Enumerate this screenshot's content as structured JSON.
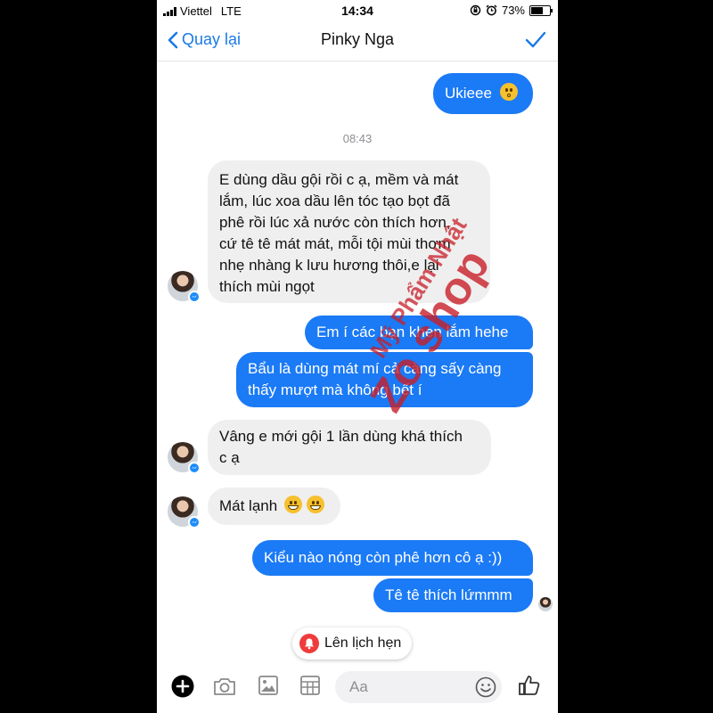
{
  "status_bar": {
    "carrier": "Viettel",
    "network": "LTE",
    "time": "14:34",
    "battery": "73%",
    "battery_level": 0.73,
    "icons": [
      "signal-icon",
      "orientation-lock-icon",
      "alarm-icon",
      "battery-icon"
    ]
  },
  "header": {
    "back_label": "Quay lại",
    "title": "Pinky Nga",
    "done_icon": "checkmark-icon"
  },
  "messages": {
    "m1": "Ukieee",
    "timestamp": "08:43",
    "m2_lines": [
      "E dùng dầu gội rồi c ạ, mềm và mát",
      "lắm, lúc xoa dầu lên tóc tạo bọt đã",
      "phê rồi lúc xả nước còn thích hơn,",
      "cứ tê tê mát mát, mỗi tội mùi thơm",
      "nhẹ nhàng k lưu hương thôi,e lại",
      "thích mùi ngọt"
    ],
    "m3": "Em í các bạn khen lắm hehe",
    "m4_lines": [
      "Bẩu là dùng mát mí cả càng sấy càng",
      "thấy mượt mà không bết í"
    ],
    "m5_lines": [
      "Vâng e mới gội 1 lần dùng khá thích",
      "c ạ"
    ],
    "m6": "Mát lạnh",
    "m7": "Kiểu nào nóng còn phê hơn cô ạ :))",
    "m8": "Tê tê thích lứmmm"
  },
  "watermark": {
    "line1": "Mỹ Phẩm Nhật",
    "line2": "Zo shop"
  },
  "reminder_chip": {
    "label": "Lên lịch hẹn"
  },
  "composer": {
    "placeholder": "Aa",
    "icons": [
      "plus-icon",
      "camera-icon",
      "photo-icon",
      "gif-grid-icon",
      "emoji-icon",
      "thumbs-up-icon"
    ]
  },
  "colors": {
    "accent": "#1a7ae6",
    "outgoing_bubble": "#1b7af5",
    "incoming_bubble": "#efefef",
    "watermark": "#c81e28",
    "reminder": "#ef3b3b"
  }
}
